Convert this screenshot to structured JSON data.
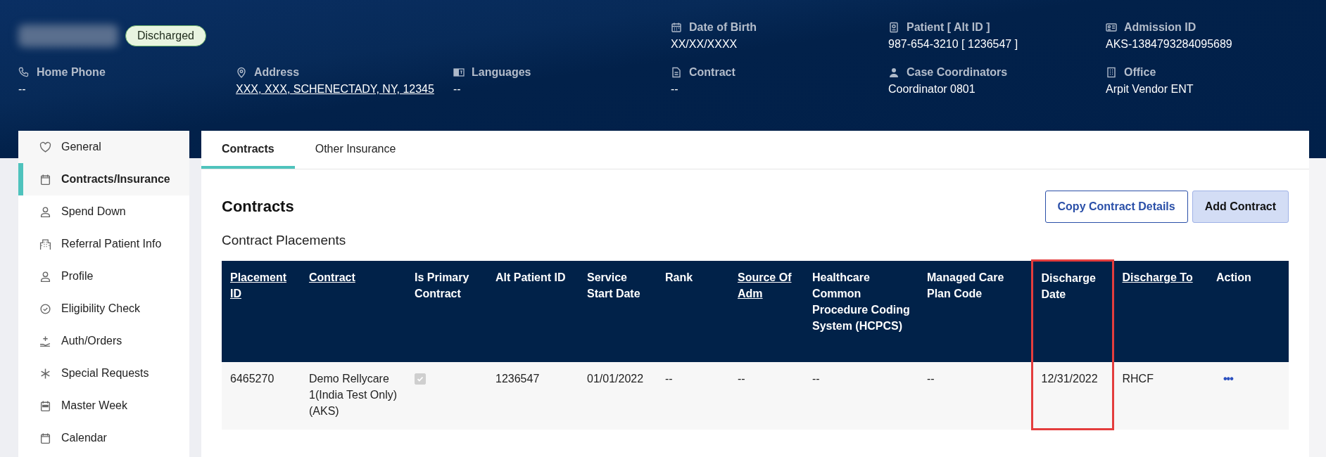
{
  "patient": {
    "name_redacted": true,
    "status": "Discharged"
  },
  "header_fields": [
    {
      "label": "Date of Birth",
      "value": "XX/XX/XXXX"
    },
    {
      "label": "Patient [ Alt ID ]",
      "value": "987-654-3210 [ 1236547 ]"
    },
    {
      "label": "Admission ID",
      "value": "AKS-1384793284095689"
    },
    {
      "label": "Home Phone",
      "value": "--"
    },
    {
      "label": "Address",
      "value": "XXX, XXX, SCHENECTADY, NY, 12345",
      "link": true
    },
    {
      "label": "Languages",
      "value": "--"
    },
    {
      "label": "Contract",
      "value": "--"
    },
    {
      "label": "Case Coordinators",
      "value": "Coordinator 0801"
    },
    {
      "label": "Office",
      "value": "Arpit Vendor ENT"
    }
  ],
  "sidebar": {
    "items": [
      {
        "label": "General",
        "selected": false
      },
      {
        "label": "Contracts/Insurance",
        "selected": true
      },
      {
        "label": "Spend Down",
        "selected": false
      },
      {
        "label": "Referral Patient Info",
        "selected": false
      },
      {
        "label": "Profile",
        "selected": false
      },
      {
        "label": "Eligibility Check",
        "selected": false
      },
      {
        "label": "Auth/Orders",
        "selected": false
      },
      {
        "label": "Special Requests",
        "selected": false
      },
      {
        "label": "Master Week",
        "selected": false
      },
      {
        "label": "Calendar",
        "selected": false
      }
    ]
  },
  "tabs": [
    {
      "label": "Contracts",
      "selected": true
    },
    {
      "label": "Other Insurance",
      "selected": false
    }
  ],
  "section": {
    "title": "Contracts",
    "subtitle": "Contract Placements"
  },
  "buttons": [
    {
      "label": "Copy Contract Details",
      "kind": "outline"
    },
    {
      "label": "Add Contract",
      "kind": "filled"
    }
  ],
  "table": {
    "columns": [
      {
        "label": "Placement ID",
        "sortable": true,
        "highlighted": false
      },
      {
        "label": "Contract",
        "sortable": true,
        "highlighted": false
      },
      {
        "label": "Is Primary Contract",
        "sortable": false,
        "highlighted": false
      },
      {
        "label": "Alt Patient ID",
        "sortable": false,
        "highlighted": false
      },
      {
        "label": "Service Start Date",
        "sortable": false,
        "highlighted": false
      },
      {
        "label": "Rank",
        "sortable": false,
        "highlighted": false
      },
      {
        "label": "Source Of Adm",
        "sortable": true,
        "highlighted": false
      },
      {
        "label": "Healthcare Common Procedure Coding System (HCPCS)",
        "sortable": false,
        "highlighted": false
      },
      {
        "label": "Managed Care Plan Code",
        "sortable": false,
        "highlighted": false
      },
      {
        "label": "Discharge Date",
        "sortable": false,
        "highlighted": true
      },
      {
        "label": "Discharge To",
        "sortable": true,
        "highlighted": false
      },
      {
        "label": "Action",
        "sortable": false,
        "highlighted": false
      }
    ],
    "rows": [
      {
        "cells": [
          {
            "kind": "text",
            "text": "6465270"
          },
          {
            "kind": "text",
            "text": "Demo Rellycare 1(India Test Only) (AKS)"
          },
          {
            "kind": "checkbox",
            "checked": true,
            "disabled": true
          },
          {
            "kind": "text",
            "text": "1236547"
          },
          {
            "kind": "text",
            "text": "01/01/2022"
          },
          {
            "kind": "text",
            "text": "--"
          },
          {
            "kind": "text",
            "text": "--"
          },
          {
            "kind": "text",
            "text": "--"
          },
          {
            "kind": "text",
            "text": "--"
          },
          {
            "kind": "text",
            "text": "12/31/2022"
          },
          {
            "kind": "text",
            "text": "RHCF"
          },
          {
            "kind": "menu",
            "text": "•••"
          }
        ]
      }
    ]
  }
}
